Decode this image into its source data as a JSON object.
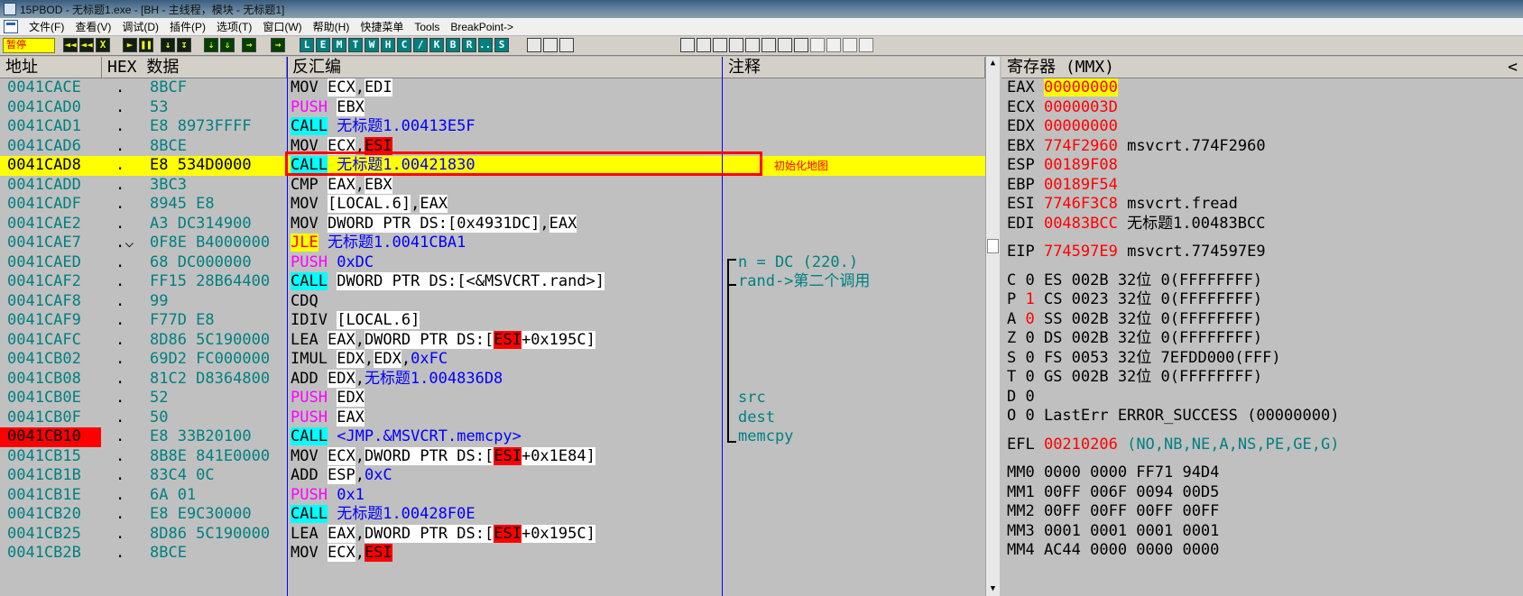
{
  "window": {
    "title": "15PBOD - 无标题1.exe - [BH - 主线程，模块 - 无标题1]"
  },
  "menu": [
    "文件(F)",
    "查看(V)",
    "调试(D)",
    "插件(P)",
    "选项(T)",
    "窗口(W)",
    "帮助(H)",
    "快捷菜单",
    "Tools",
    "BreakPoint->"
  ],
  "toolbar": {
    "status": "暂停",
    "buttons": [
      {
        "name": "open-button",
        "glyph": "◄◄",
        "style": "dark"
      },
      {
        "name": "restart-button",
        "glyph": "◄◄",
        "style": "dark"
      },
      {
        "name": "close-button",
        "glyph": "X",
        "style": "dark"
      },
      {
        "name": "run-button",
        "glyph": "►",
        "style": "dark"
      },
      {
        "name": "pause-button",
        "glyph": "❚❚",
        "style": "dark"
      },
      {
        "name": "step-into-button",
        "glyph": "↓",
        "style": "dark"
      },
      {
        "name": "step-over-button",
        "glyph": "↧",
        "style": "dark"
      },
      {
        "name": "trace-into-button",
        "glyph": "⇣",
        "style": "green"
      },
      {
        "name": "trace-over-button",
        "glyph": "⇓",
        "style": "green"
      },
      {
        "name": "execute-till-return-button",
        "glyph": "→",
        "style": "green"
      },
      {
        "name": "goto-button",
        "glyph": "→",
        "style": "green"
      }
    ],
    "window_buttons": [
      "L",
      "E",
      "M",
      "T",
      "W",
      "H",
      "C",
      "/",
      "K",
      "B",
      "R",
      "...",
      "S"
    ]
  },
  "disasm": {
    "headers": {
      "address": "地址",
      "hex": "HEX 数据",
      "disasm": "反汇编",
      "comment": "注释"
    },
    "rows": [
      {
        "addr": "0041CACE",
        "jmp": ".",
        "hex": "8BCF",
        "m": "MOV",
        "ops": [
          {
            "t": "ECX",
            "box": 1
          },
          {
            "t": ","
          },
          {
            "t": "EDI",
            "box": 1
          }
        ],
        "cmt": ""
      },
      {
        "addr": "0041CAD0",
        "jmp": ".",
        "hex": "53",
        "m": "PUSH",
        "mk": "push",
        "ops": [
          {
            "t": "EBX",
            "box": 1
          }
        ],
        "cmt": ""
      },
      {
        "addr": "0041CAD1",
        "jmp": ".",
        "hex": "E8 8973FFFF",
        "m": "CALL",
        "mk": "call",
        "ops": [
          {
            "t": "无标题1.00413E5F",
            "c": "blue"
          }
        ],
        "cmt": ""
      },
      {
        "addr": "0041CAD6",
        "jmp": ".",
        "hex": "8BCE",
        "m": "MOV",
        "ops": [
          {
            "t": "ECX",
            "box": 1
          },
          {
            "t": ","
          },
          {
            "t": "ESI",
            "red": 1
          }
        ],
        "cmt": ""
      },
      {
        "addr": "0041CAD8",
        "jmp": ".",
        "hex": "E8 534D0000",
        "m": "CALL",
        "mk": "call",
        "ops": [
          {
            "t": "无标题1.00421830",
            "c": "blue"
          }
        ],
        "cmt": "",
        "sel": true
      },
      {
        "addr": "0041CADD",
        "jmp": ".",
        "hex": "3BC3",
        "m": "CMP",
        "ops": [
          {
            "t": "EAX",
            "box": 1
          },
          {
            "t": ","
          },
          {
            "t": "EBX",
            "box": 1
          }
        ],
        "cmt": ""
      },
      {
        "addr": "0041CADF",
        "jmp": ".",
        "hex": "8945 E8",
        "m": "MOV",
        "ops": [
          {
            "t": "[LOCAL.6]",
            "box": 1
          },
          {
            "t": ","
          },
          {
            "t": "EAX",
            "box": 1
          }
        ],
        "cmt": ""
      },
      {
        "addr": "0041CAE2",
        "jmp": ".",
        "hex": "A3 DC314900",
        "m": "MOV",
        "ops": [
          {
            "t": "DWORD PTR DS:[0x4931DC]",
            "box": 1
          },
          {
            "t": ","
          },
          {
            "t": "EAX",
            "box": 1
          }
        ],
        "cmt": ""
      },
      {
        "addr": "0041CAE7",
        "jmp": ".⌵",
        "hex": "0F8E B4000000",
        "m": "JLE",
        "mk": "jcc",
        "ops": [
          {
            "t": "无标题1.0041CBA1",
            "c": "blue"
          }
        ],
        "cmt": ""
      },
      {
        "addr": "0041CAED",
        "jmp": ".",
        "hex": "68 DC000000",
        "m": "PUSH",
        "mk": "push",
        "ops": [
          {
            "t": "0xDC",
            "c": "blue"
          }
        ],
        "cmt": "n = DC (220.)"
      },
      {
        "addr": "0041CAF2",
        "jmp": ".",
        "hex": "FF15 28B64400",
        "m": "CALL",
        "mk": "call",
        "ops": [
          {
            "t": "DWORD PTR DS:[<&MSVCRT.rand>]",
            "box": 1
          }
        ],
        "cmt": "rand->第二个调用"
      },
      {
        "addr": "0041CAF8",
        "jmp": ".",
        "hex": "99",
        "m": "CDQ",
        "ops": [],
        "cmt": ""
      },
      {
        "addr": "0041CAF9",
        "jmp": ".",
        "hex": "F77D E8",
        "m": "IDIV",
        "ops": [
          {
            "t": "[LOCAL.6]",
            "box": 1
          }
        ],
        "cmt": ""
      },
      {
        "addr": "0041CAFC",
        "jmp": ".",
        "hex": "8D86 5C190000",
        "m": "LEA",
        "ops": [
          {
            "t": "EAX",
            "box": 1
          },
          {
            "t": ","
          },
          {
            "t": "DWORD PTR DS:[",
            "box": 1
          },
          {
            "t": "ESI",
            "red": 1
          },
          {
            "t": "+0x195C]",
            "box": 1
          }
        ],
        "cmt": ""
      },
      {
        "addr": "0041CB02",
        "jmp": ".",
        "hex": "69D2 FC000000",
        "m": "IMUL",
        "ops": [
          {
            "t": "EDX",
            "box": 1
          },
          {
            "t": ","
          },
          {
            "t": "EDX",
            "box": 1
          },
          {
            "t": ","
          },
          {
            "t": "0xFC",
            "c": "blue"
          }
        ],
        "cmt": ""
      },
      {
        "addr": "0041CB08",
        "jmp": ".",
        "hex": "81C2 D8364800",
        "m": "ADD",
        "ops": [
          {
            "t": "EDX",
            "box": 1
          },
          {
            "t": ","
          },
          {
            "t": "无标题1.004836D8",
            "c": "blue"
          }
        ],
        "cmt": ""
      },
      {
        "addr": "0041CB0E",
        "jmp": ".",
        "hex": "52",
        "m": "PUSH",
        "mk": "push",
        "ops": [
          {
            "t": "EDX",
            "box": 1
          }
        ],
        "cmt": "src"
      },
      {
        "addr": "0041CB0F",
        "jmp": ".",
        "hex": "50",
        "m": "PUSH",
        "mk": "push",
        "ops": [
          {
            "t": "EAX",
            "box": 1
          }
        ],
        "cmt": "dest"
      },
      {
        "addr": "0041CB10",
        "jmp": ".",
        "hex": "E8 33B20100",
        "m": "CALL",
        "mk": "call",
        "ops": [
          {
            "t": "<JMP.&MSVCRT.memcpy>",
            "c": "blue"
          }
        ],
        "cmt": "memcpy",
        "bp": true
      },
      {
        "addr": "0041CB15",
        "jmp": ".",
        "hex": "8B8E 841E0000",
        "m": "MOV",
        "ops": [
          {
            "t": "ECX",
            "box": 1
          },
          {
            "t": ","
          },
          {
            "t": "DWORD PTR DS:[",
            "box": 1
          },
          {
            "t": "ESI",
            "red": 1
          },
          {
            "t": "+0x1E84]",
            "box": 1
          }
        ],
        "cmt": ""
      },
      {
        "addr": "0041CB1B",
        "jmp": ".",
        "hex": "83C4 0C",
        "m": "ADD",
        "ops": [
          {
            "t": "ESP",
            "box": 1
          },
          {
            "t": ","
          },
          {
            "t": "0xC",
            "c": "blue"
          }
        ],
        "cmt": ""
      },
      {
        "addr": "0041CB1E",
        "jmp": ".",
        "hex": "6A 01",
        "m": "PUSH",
        "mk": "push",
        "ops": [
          {
            "t": "0x1",
            "c": "blue"
          }
        ],
        "cmt": ""
      },
      {
        "addr": "0041CB20",
        "jmp": ".",
        "hex": "E8 E9C30000",
        "m": "CALL",
        "mk": "call",
        "ops": [
          {
            "t": "无标题1.00428F0E",
            "c": "blue"
          }
        ],
        "cmt": ""
      },
      {
        "addr": "0041CB25",
        "jmp": ".",
        "hex": "8D86 5C190000",
        "m": "LEA",
        "ops": [
          {
            "t": "EAX",
            "box": 1
          },
          {
            "t": ","
          },
          {
            "t": "DWORD PTR DS:[",
            "box": 1
          },
          {
            "t": "ESI",
            "red": 1
          },
          {
            "t": "+0x195C]",
            "box": 1
          }
        ],
        "cmt": ""
      },
      {
        "addr": "0041CB2B",
        "jmp": ".",
        "hex": "8BCE",
        "m": "MOV",
        "ops": [
          {
            "t": "ECX",
            "box": 1
          },
          {
            "t": ","
          },
          {
            "t": "ESI",
            "red": 1
          }
        ],
        "cmt": ""
      }
    ]
  },
  "annotation": "初始化地图",
  "registers": {
    "header": "寄存器 (MMX)",
    "collapse_glyph": "<",
    "lines": [
      [
        {
          "t": "EAX "
        },
        {
          "t": "00000000",
          "c": "yel"
        }
      ],
      [
        {
          "t": "ECX "
        },
        {
          "t": "0000003D",
          "c": "red"
        }
      ],
      [
        {
          "t": "EDX "
        },
        {
          "t": "00000000",
          "c": "red"
        }
      ],
      [
        {
          "t": "EBX "
        },
        {
          "t": "774F2960",
          "c": "red"
        },
        {
          "t": " msvcrt.774F2960"
        }
      ],
      [
        {
          "t": "ESP "
        },
        {
          "t": "00189F08",
          "c": "red"
        }
      ],
      [
        {
          "t": "EBP "
        },
        {
          "t": "00189F54",
          "c": "red"
        }
      ],
      [
        {
          "t": "ESI "
        },
        {
          "t": "7746F3C8",
          "c": "red"
        },
        {
          "t": " msvcrt.fread"
        }
      ],
      [
        {
          "t": "EDI "
        },
        {
          "t": "00483BCC",
          "c": "red"
        },
        {
          "t": " 无标题1.00483BCC"
        }
      ],
      [
        {
          "t": ""
        }
      ],
      [
        {
          "t": "EIP "
        },
        {
          "t": "774597E9",
          "c": "red"
        },
        {
          "t": " msvcrt.774597E9"
        }
      ],
      [
        {
          "t": ""
        }
      ],
      [
        {
          "t": "C 0   ES 002B 32位 0(FFFFFFFF)"
        }
      ],
      [
        {
          "t": "P "
        },
        {
          "t": "1",
          "c": "red"
        },
        {
          "t": "   CS 0023 32位 0(FFFFFFFF)"
        }
      ],
      [
        {
          "t": "A "
        },
        {
          "t": "0",
          "c": "red"
        },
        {
          "t": "   SS 002B 32位 0(FFFFFFFF)"
        }
      ],
      [
        {
          "t": "Z 0   DS 002B 32位 0(FFFFFFFF)"
        }
      ],
      [
        {
          "t": "S 0   FS 0053 32位 7EFDD000(FFF)"
        }
      ],
      [
        {
          "t": "T 0   GS 002B 32位 0(FFFFFFFF)"
        }
      ],
      [
        {
          "t": "D 0"
        }
      ],
      [
        {
          "t": "O 0   LastErr ERROR_SUCCESS (00000000)"
        }
      ],
      [
        {
          "t": ""
        }
      ],
      [
        {
          "t": "EFL "
        },
        {
          "t": "00210206",
          "c": "red"
        },
        {
          "t": " (NO,NB,NE,A,NS,PE,GE,G)",
          "c": "teal"
        }
      ],
      [
        {
          "t": ""
        }
      ],
      [
        {
          "t": "MM0 0000 0000 FF71 94D4"
        }
      ],
      [
        {
          "t": "MM1 00FF 006F 0094 00D5"
        }
      ],
      [
        {
          "t": "MM2 00FF 00FF 00FF 00FF"
        }
      ],
      [
        {
          "t": "MM3 0001 0001 0001 0001"
        }
      ],
      [
        {
          "t": "MM4 AC44 0000 0000 0000"
        }
      ]
    ]
  }
}
